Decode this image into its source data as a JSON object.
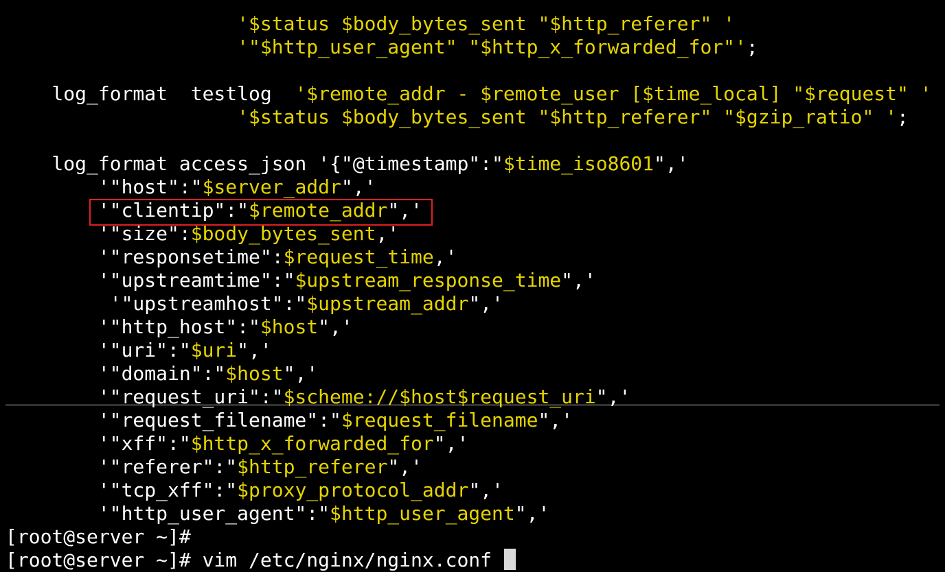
{
  "terminal": {
    "colors": {
      "background": "#000000",
      "text": "#ffffff",
      "string": "#e5d400",
      "highlight_border": "#e02020"
    },
    "lines": [
      {
        "segments": [
          {
            "t": "                    ",
            "c": "w"
          },
          {
            "t": "'$status $body_bytes_sent \"$http_referer\" '",
            "c": "y"
          }
        ]
      },
      {
        "segments": [
          {
            "t": "                    ",
            "c": "w"
          },
          {
            "t": "'\"$http_user_agent\" \"$http_x_forwarded_for\"'",
            "c": "y"
          },
          {
            "t": ";",
            "c": "w"
          }
        ]
      },
      {
        "segments": [
          {
            "t": "",
            "c": "w"
          }
        ]
      },
      {
        "segments": [
          {
            "t": "    log_format  testlog  ",
            "c": "w"
          },
          {
            "t": "'$remote_addr - $remote_user [$time_local] \"$request\" '",
            "c": "y"
          }
        ]
      },
      {
        "segments": [
          {
            "t": "                    ",
            "c": "w"
          },
          {
            "t": "'$status $body_bytes_sent \"$http_referer\" \"$gzip_ratio\" '",
            "c": "y"
          },
          {
            "t": ";",
            "c": "w"
          }
        ]
      },
      {
        "segments": [
          {
            "t": "",
            "c": "w"
          }
        ]
      },
      {
        "segments": [
          {
            "t": "    log_format access_json '{\"@timestamp\":\"",
            "c": "w"
          },
          {
            "t": "$time_iso8601",
            "c": "y"
          },
          {
            "t": "\",'",
            "c": "w"
          }
        ]
      },
      {
        "segments": [
          {
            "t": "        '\"host\":\"",
            "c": "w"
          },
          {
            "t": "$server_addr",
            "c": "y"
          },
          {
            "t": "\",'",
            "c": "w"
          }
        ]
      },
      {
        "segments": [
          {
            "t": "        '\"clientip\":\"",
            "c": "w"
          },
          {
            "t": "$remote_addr",
            "c": "y"
          },
          {
            "t": "\",'",
            "c": "w"
          }
        ]
      },
      {
        "segments": [
          {
            "t": "        '\"size\":",
            "c": "w"
          },
          {
            "t": "$body_bytes_sent",
            "c": "y"
          },
          {
            "t": ",'",
            "c": "w"
          }
        ]
      },
      {
        "segments": [
          {
            "t": "        '\"responsetime\":",
            "c": "w"
          },
          {
            "t": "$request_time",
            "c": "y"
          },
          {
            "t": ",'",
            "c": "w"
          }
        ]
      },
      {
        "segments": [
          {
            "t": "        '\"upstreamtime\":\"",
            "c": "w"
          },
          {
            "t": "$upstream_response_time",
            "c": "y"
          },
          {
            "t": "\",'",
            "c": "w"
          }
        ]
      },
      {
        "segments": [
          {
            "t": "         '\"upstreamhost\":\"",
            "c": "w"
          },
          {
            "t": "$upstream_addr",
            "c": "y"
          },
          {
            "t": "\",'",
            "c": "w"
          }
        ]
      },
      {
        "segments": [
          {
            "t": "        '\"http_host\":\"",
            "c": "w"
          },
          {
            "t": "$host",
            "c": "y"
          },
          {
            "t": "\",'",
            "c": "w"
          }
        ]
      },
      {
        "segments": [
          {
            "t": "        '\"uri\":\"",
            "c": "w"
          },
          {
            "t": "$uri",
            "c": "y"
          },
          {
            "t": "\",'",
            "c": "w"
          }
        ]
      },
      {
        "segments": [
          {
            "t": "        '\"domain\":\"",
            "c": "w"
          },
          {
            "t": "$host",
            "c": "y"
          },
          {
            "t": "\",'",
            "c": "w"
          }
        ]
      },
      {
        "segments": [
          {
            "t": "        '\"request_uri\":\"",
            "c": "w"
          },
          {
            "t": "$scheme://$host$request_uri",
            "c": "y"
          },
          {
            "t": "\",'",
            "c": "w"
          }
        ]
      },
      {
        "segments": [
          {
            "t": "        '\"request_filename\":\"",
            "c": "w"
          },
          {
            "t": "$request_filename",
            "c": "y"
          },
          {
            "t": "\",'",
            "c": "w"
          }
        ]
      },
      {
        "segments": [
          {
            "t": "        '\"xff\":\"",
            "c": "w"
          },
          {
            "t": "$http_x_forwarded_for",
            "c": "y"
          },
          {
            "t": "\",'",
            "c": "w"
          }
        ]
      },
      {
        "segments": [
          {
            "t": "        '\"referer\":\"",
            "c": "w"
          },
          {
            "t": "$http_referer",
            "c": "y"
          },
          {
            "t": "\",'",
            "c": "w"
          }
        ]
      },
      {
        "segments": [
          {
            "t": "        '\"tcp_xff\":\"",
            "c": "w"
          },
          {
            "t": "$proxy_protocol_addr",
            "c": "y"
          },
          {
            "t": "\",'",
            "c": "w"
          }
        ]
      },
      {
        "segments": [
          {
            "t": "        '\"http_user_agent\":\"",
            "c": "w"
          },
          {
            "t": "$http_user_agent",
            "c": "y"
          },
          {
            "t": "\",'",
            "c": "w"
          }
        ]
      },
      {
        "segments": [
          {
            "t": "[root@server ~]#",
            "c": "w"
          }
        ]
      },
      {
        "segments": [
          {
            "t": "[root@server ~]# vim /etc/nginx/nginx.conf ",
            "c": "w"
          }
        ],
        "cursor": true
      }
    ]
  }
}
